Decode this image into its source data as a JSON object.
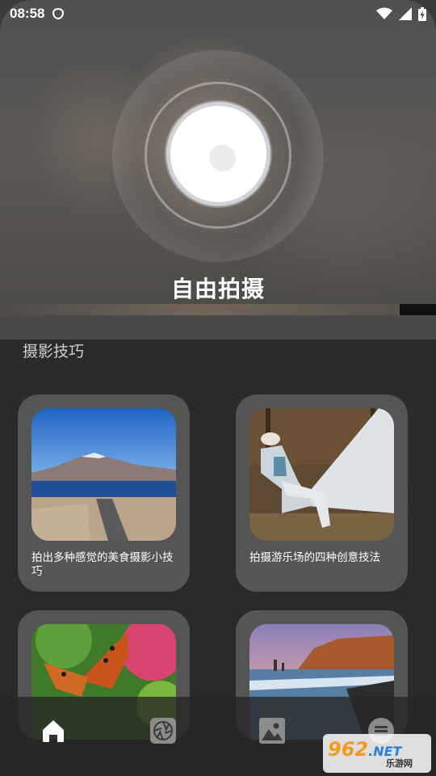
{
  "status_bar": {
    "time": "08:58"
  },
  "hero": {
    "title": "自由拍摄"
  },
  "section": {
    "title": "摄影技巧"
  },
  "cards": [
    {
      "label": "拍出多种感觉的美食摄影小技巧",
      "image": "mountain-lake-road-photo"
    },
    {
      "label": "拍摄游乐场的四种创意技法",
      "image": "woman-tent-camping-photo"
    },
    {
      "label": "",
      "image": "butterfly-flower-photo"
    },
    {
      "label": "",
      "image": "coastline-sunset-photo"
    }
  ],
  "bottom_nav": {
    "items": [
      "home-icon",
      "camera-aperture-icon",
      "gallery-icon",
      "menu-icon"
    ],
    "active": "home-icon"
  },
  "watermark": {
    "logo": "962",
    "net": ".NET",
    "text": "乐游网"
  },
  "colors": {
    "accent": "#ffffff",
    "card_bg": "#787878",
    "background": "#2b2b2b"
  }
}
